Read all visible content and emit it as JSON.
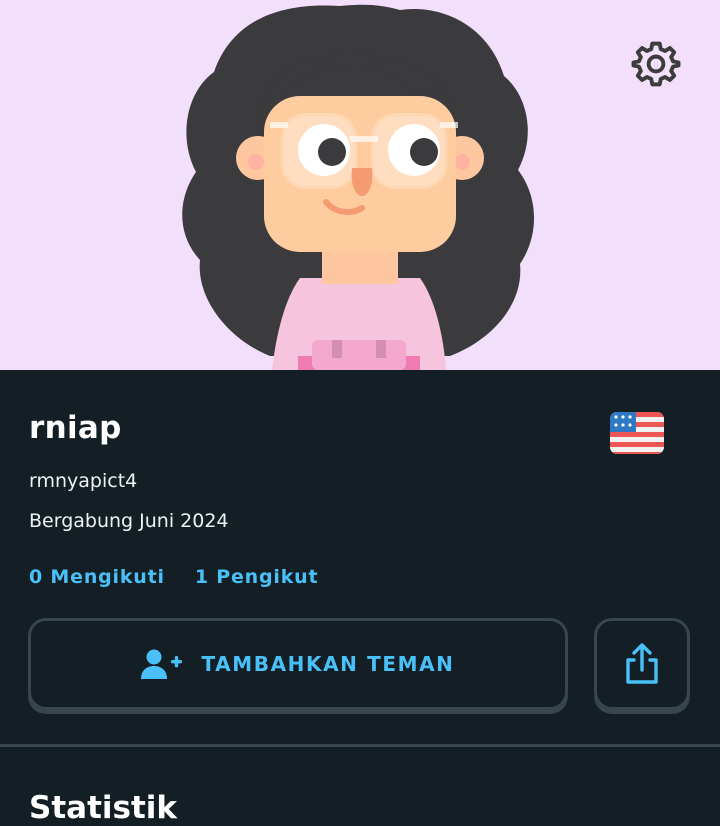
{
  "header": {
    "settings_icon": "gear-icon",
    "avatar": "user-avatar-illustration"
  },
  "profile": {
    "display_name": "rniap",
    "username": "rmnyapict4",
    "joined": "Bergabung Juni 2024",
    "flag_icon": "us-flag-icon",
    "following": "0 Mengikuti",
    "followers": "1 Pengikut"
  },
  "actions": {
    "add_friend_label": "TAMBAHKAN TEMAN",
    "add_friend_icon": "add-user-icon",
    "share_icon": "share-icon"
  },
  "sections": {
    "statistics_title": "Statistik"
  },
  "colors": {
    "hero_background": "#f2dffb",
    "page_background": "#131f24",
    "accent": "#49c0f8",
    "border": "#37464f",
    "text": "#ffffff"
  }
}
